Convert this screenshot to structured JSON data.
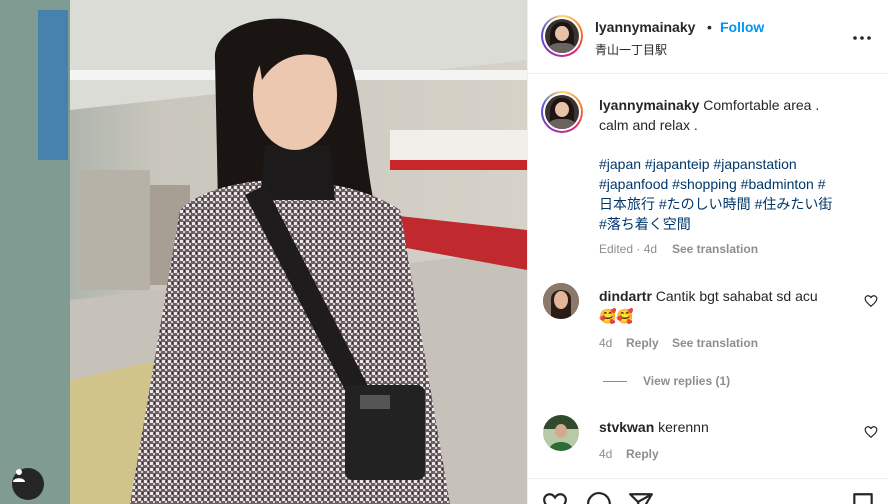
{
  "post": {
    "username": "lyannymainaky",
    "follow_label": "Follow",
    "separator": "•",
    "location": "青山一丁目駅",
    "more_icon": "more-horizontal-icon"
  },
  "caption": {
    "username": "lyannymainaky",
    "text_line1": "Comfortable area .",
    "text_line2": "calm and relax .",
    "hashtags_line1": "#japan #japanteip #japanstation",
    "hashtags_line2": "#japanfood #shopping #badminton #",
    "hashtags_line3": "日本旅行 #たのしい時間 #住みたい街",
    "hashtags_line4": "#落ち着く空間",
    "edited_label": "Edited · 4d",
    "translate_label": "See translation"
  },
  "comments": [
    {
      "username": "dindartr",
      "text_line1": "Cantik bgt sahabat sd acu",
      "text_line2": "🥰🥰",
      "time": "4d",
      "reply_label": "Reply",
      "translate_label": "See translation",
      "view_replies": "View replies (1)"
    },
    {
      "username": "stvkwan",
      "text_line1": "kerennn",
      "time": "4d",
      "reply_label": "Reply"
    }
  ],
  "icons": {
    "like": "heart-icon",
    "comment": "comment-icon",
    "share": "paper-plane-icon",
    "save": "bookmark-icon",
    "tag": "user-tag-icon"
  },
  "colors": {
    "accent": "#0095f6",
    "hashtag": "#00376b",
    "muted": "#8e8e8e",
    "text": "#262626"
  }
}
